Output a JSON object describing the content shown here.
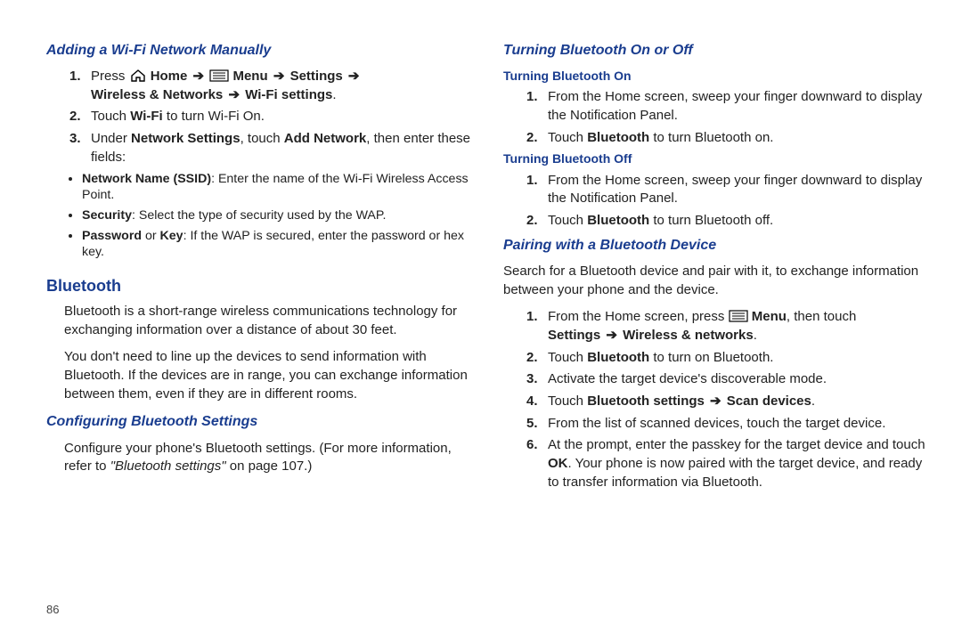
{
  "pageNumber": "86",
  "left": {
    "h1": "Adding a Wi-Fi Network Manually",
    "step1_a": "Press ",
    "step1_home": "Home",
    "step1_menu": "Menu",
    "step1_settings": "Settings",
    "step1_b": "Wireless & Networks",
    "step1_c": "Wi-Fi settings",
    "step2_a": "Touch ",
    "step2_b": "Wi-Fi",
    "step2_c": " to turn Wi-Fi On.",
    "step3_a": "Under ",
    "step3_b": "Network Settings",
    "step3_c": ", touch ",
    "step3_d": "Add Network",
    "step3_e": ", then enter these fields:",
    "bullet1_a": "Network Name (SSID)",
    "bullet1_b": ": Enter the name of the Wi-Fi Wireless Access Point.",
    "bullet2_a": "Security",
    "bullet2_b": ": Select the type of security used by the WAP.",
    "bullet3_a": "Password",
    "bullet3_mid": " or ",
    "bullet3_b": "Key",
    "bullet3_c": ": If the WAP is secured, enter the password or hex key.",
    "h2": "Bluetooth",
    "para1": "Bluetooth is a short-range wireless communications technology for exchanging information over a distance of about 30 feet.",
    "para2": "You don't need to line up the devices to send information with Bluetooth. If the devices are in range, you can exchange information between them, even if they are in different rooms.",
    "h3": "Configuring Bluetooth Settings",
    "para3_a": "Configure your phone's Bluetooth settings. (For more information, refer to ",
    "para3_b": "\"Bluetooth settings\"",
    "para3_c": " on page 107.)"
  },
  "right": {
    "h1": "Turning Bluetooth On or Off",
    "hOn": "Turning Bluetooth On",
    "on1": "From the Home screen, sweep your finger downward to display the Notification Panel.",
    "on2_a": "Touch ",
    "on2_b": "Bluetooth",
    "on2_c": " to turn Bluetooth on.",
    "hOff": "Turning Bluetooth Off",
    "off1": "From the Home screen, sweep your finger downward to display the Notification Panel.",
    "off2_a": "Touch ",
    "off2_b": "Bluetooth",
    "off2_c": " to turn Bluetooth off.",
    "h2": "Pairing with a Bluetooth Device",
    "para1": "Search for a Bluetooth device and pair with it, to exchange information between your phone and the device.",
    "p1_a": "From the Home screen, press ",
    "p1_menu": "Menu",
    "p1_b": ", then touch ",
    "p1_c": "Settings",
    "p1_d": "Wireless & networks",
    "p2_a": "Touch ",
    "p2_b": "Bluetooth",
    "p2_c": " to turn on Bluetooth.",
    "p3": "Activate the target device's discoverable mode.",
    "p4_a": "Touch ",
    "p4_b": "Bluetooth settings",
    "p4_c": "Scan devices",
    "p5": "From the list of scanned devices, touch the target device.",
    "p6_a": "At the prompt, enter the passkey for the target device and touch ",
    "p6_b": "OK",
    "p6_c": ". Your phone is now paired with the target device, and ready to transfer information via Bluetooth."
  }
}
